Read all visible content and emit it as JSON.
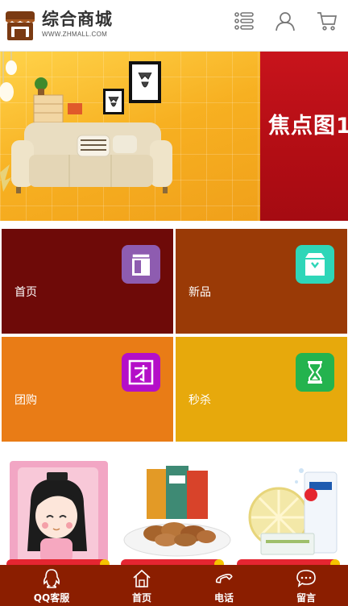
{
  "header": {
    "brand_name": "综合商城",
    "brand_url": "WWW.ZHMALL.COM",
    "icons": [
      "store-logo-icon",
      "menu-list-icon",
      "user-icon",
      "cart-icon"
    ]
  },
  "banner": {
    "slide2_text": "焦点图1"
  },
  "grid": {
    "tiles": [
      {
        "label": "首页",
        "color": "#6e0a08",
        "icon_color": "#8e5cb0",
        "icon": "page-icon"
      },
      {
        "label": "新品",
        "color": "#9a3a06",
        "icon_color": "#2ed6b8",
        "icon": "box-icon"
      },
      {
        "label": "团购",
        "color": "#e97c16",
        "icon_color": "#b40fc8",
        "icon": "group-buy-icon"
      },
      {
        "label": "秒杀",
        "color": "#e7a90c",
        "icon_color": "#24b34e",
        "icon": "hourglass-icon"
      }
    ]
  },
  "products": {
    "items": [
      "scale-product-image",
      "nuts-product-image",
      "mask-product-image"
    ]
  },
  "footer": {
    "items": [
      {
        "label": "QQ客服",
        "icon": "qq-icon"
      },
      {
        "label": "首页",
        "icon": "home-icon"
      },
      {
        "label": "电话",
        "icon": "phone-icon"
      },
      {
        "label": "留言",
        "icon": "message-icon"
      }
    ],
    "color": "#8b1e00"
  }
}
